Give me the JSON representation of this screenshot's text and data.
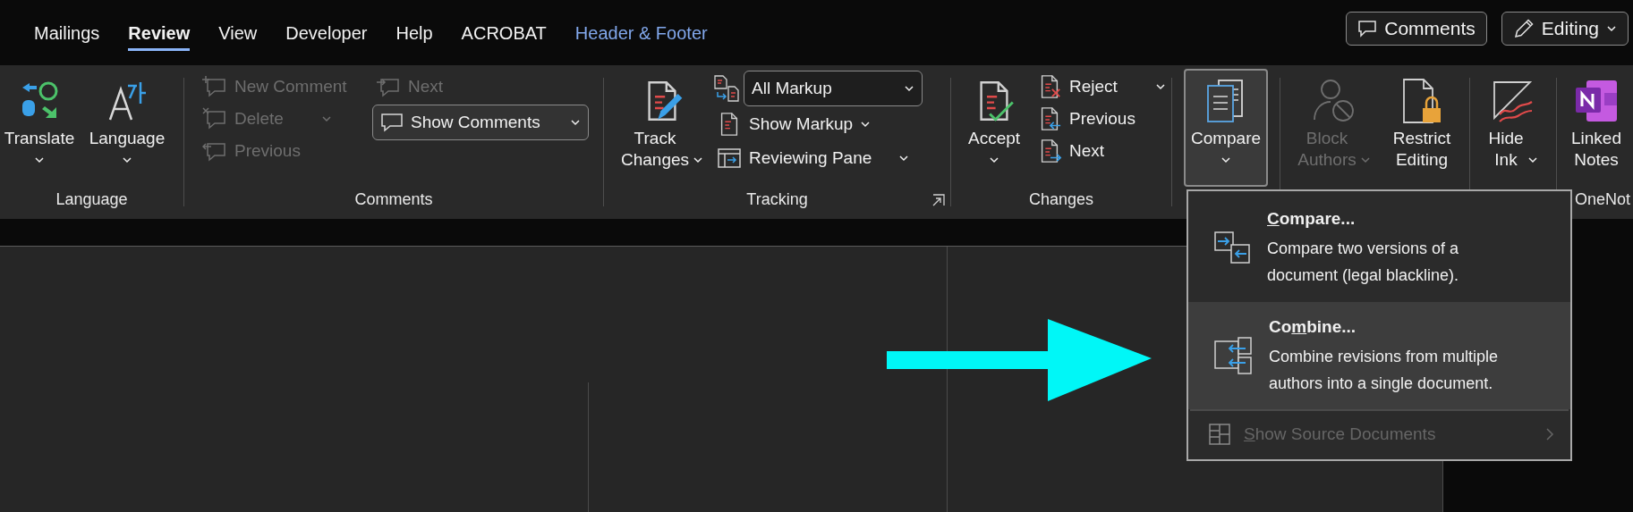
{
  "tabs": [
    {
      "label": "Mailings",
      "selected": false,
      "kind": "standard"
    },
    {
      "label": "Review",
      "selected": true,
      "kind": "standard"
    },
    {
      "label": "View",
      "selected": false,
      "kind": "standard"
    },
    {
      "label": "Developer",
      "selected": false,
      "kind": "standard"
    },
    {
      "label": "Help",
      "selected": false,
      "kind": "standard"
    },
    {
      "label": "ACROBAT",
      "selected": false,
      "kind": "standard"
    },
    {
      "label": "Header & Footer",
      "selected": false,
      "kind": "contextual"
    }
  ],
  "header_buttons": [
    {
      "label": "Comments",
      "kind": "comments"
    },
    {
      "label": "Editing",
      "kind": "editing"
    }
  ],
  "ribbon": {
    "language_group": {
      "label": "Language",
      "translate": {
        "label": "Translate"
      },
      "language": {
        "label": "Language"
      }
    },
    "comments_group": {
      "label": "Comments",
      "new_comment": {
        "label": "New Comment",
        "disabled": true
      },
      "delete": {
        "label": "Delete",
        "disabled": true
      },
      "previous": {
        "label": "Previous",
        "disabled": true
      },
      "next": {
        "label": "Next",
        "disabled": true
      },
      "show_comments": {
        "label": "Show Comments",
        "disabled": false
      }
    },
    "tracking_group": {
      "label": "Tracking",
      "track_changes": {
        "label": "Track\nChanges"
      },
      "markup_select": {
        "value": "All Markup"
      },
      "show_markup": {
        "label": "Show Markup"
      },
      "reviewing_pane": {
        "label": "Reviewing Pane"
      }
    },
    "changes_group": {
      "label": "Changes",
      "accept": {
        "label": "Accept"
      },
      "reject": {
        "label": "Reject"
      },
      "previous": {
        "label": "Previous"
      },
      "next": {
        "label": "Next"
      }
    },
    "compare_group": {
      "compare": {
        "label": "Compare",
        "selected": true
      }
    },
    "protect_group": {
      "block_authors": {
        "label": "Block\nAuthors",
        "disabled": true
      },
      "restrict_editing": {
        "label": "Restrict\nEditing",
        "disabled": false
      }
    },
    "ink_group": {
      "hide_ink": {
        "label": "Hide\nInk"
      }
    },
    "onenote_group": {
      "label": "OneNot",
      "linked_notes": {
        "label": "Linked\nNotes"
      }
    }
  },
  "compare_menu": {
    "items": [
      {
        "kind": "command",
        "title_parts": [
          {
            "text": "C",
            "underlined": true
          },
          {
            "text": "ompare...",
            "underlined": false
          }
        ],
        "description": "Compare two versions of a document (legal blackline).",
        "highlighted": false,
        "disabled": false
      },
      {
        "kind": "command",
        "title_parts": [
          {
            "text": "Co",
            "underlined": false
          },
          {
            "text": "m",
            "underlined": true
          },
          {
            "text": "bine...",
            "underlined": false
          }
        ],
        "description": "Combine revisions from multiple authors into a single document.",
        "highlighted": true,
        "disabled": false
      },
      {
        "kind": "submenu",
        "title_parts": [
          {
            "text": "S",
            "underlined": true
          },
          {
            "text": "how Source Documents",
            "underlined": false
          }
        ],
        "highlighted": false,
        "disabled": true
      }
    ]
  }
}
